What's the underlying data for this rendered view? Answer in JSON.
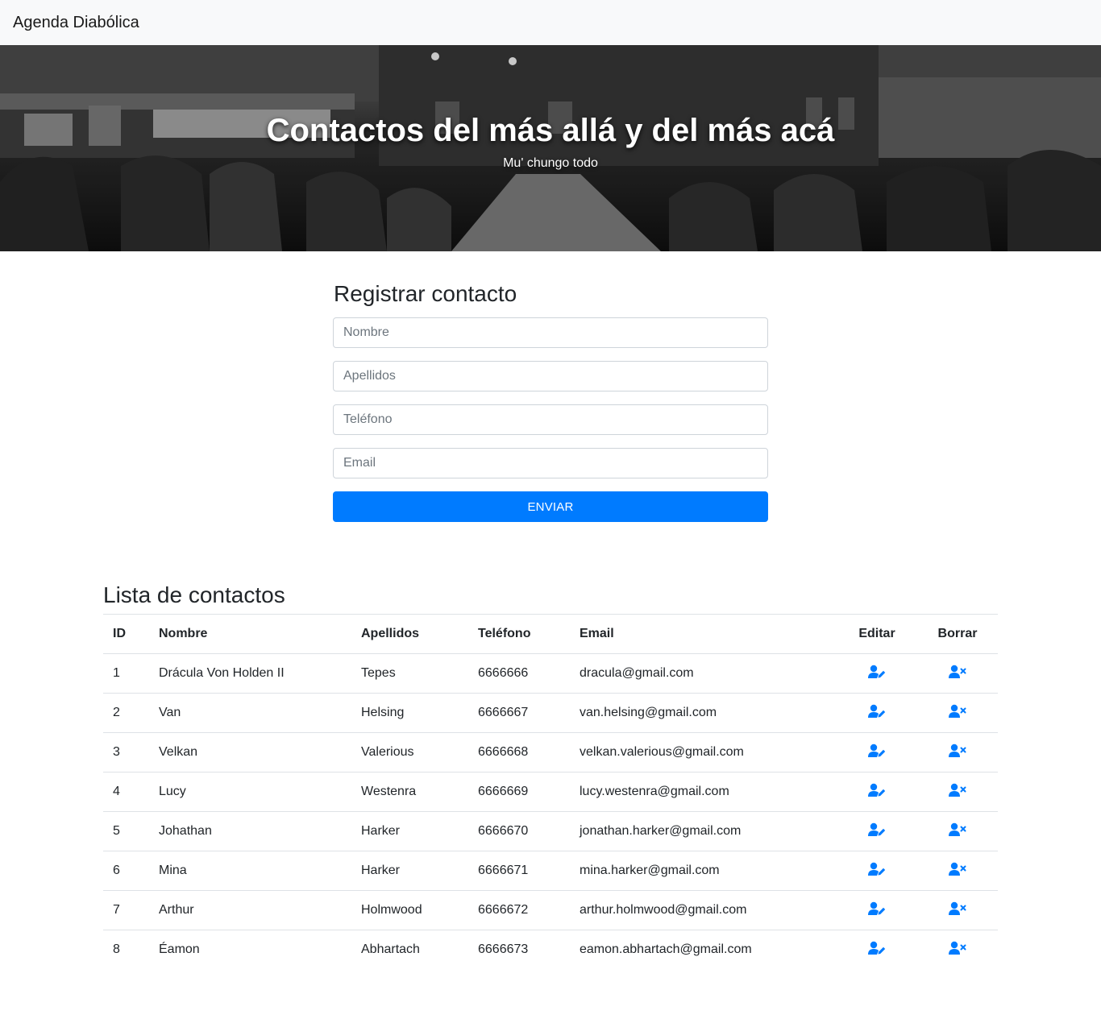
{
  "navbar": {
    "brand": "Agenda Diabólica"
  },
  "hero": {
    "title": "Contactos del más allá y del más acá",
    "subtitle": "Mu' chungo todo"
  },
  "form": {
    "title": "Registrar contacto",
    "fields": {
      "nombre": {
        "placeholder": "Nombre",
        "value": ""
      },
      "apellidos": {
        "placeholder": "Apellidos",
        "value": ""
      },
      "telefono": {
        "placeholder": "Teléfono",
        "value": ""
      },
      "email": {
        "placeholder": "Email",
        "value": ""
      }
    },
    "submit_label": "ENVIAR"
  },
  "list": {
    "title": "Lista de contactos",
    "headers": {
      "id": "ID",
      "nombre": "Nombre",
      "apellidos": "Apellidos",
      "telefono": "Teléfono",
      "email": "Email",
      "editar": "Editar",
      "borrar": "Borrar"
    },
    "rows": [
      {
        "id": "1",
        "nombre": "Drácula Von Holden II",
        "apellidos": "Tepes",
        "telefono": "6666666",
        "email": "dracula@gmail.com"
      },
      {
        "id": "2",
        "nombre": "Van",
        "apellidos": "Helsing",
        "telefono": "6666667",
        "email": "van.helsing@gmail.com"
      },
      {
        "id": "3",
        "nombre": "Velkan",
        "apellidos": "Valerious",
        "telefono": "6666668",
        "email": "velkan.valerious@gmail.com"
      },
      {
        "id": "4",
        "nombre": "Lucy",
        "apellidos": "Westenra",
        "telefono": "6666669",
        "email": "lucy.westenra@gmail.com"
      },
      {
        "id": "5",
        "nombre": "Johathan",
        "apellidos": "Harker",
        "telefono": "6666670",
        "email": "jonathan.harker@gmail.com"
      },
      {
        "id": "6",
        "nombre": "Mina",
        "apellidos": "Harker",
        "telefono": "6666671",
        "email": "mina.harker@gmail.com"
      },
      {
        "id": "7",
        "nombre": "Arthur",
        "apellidos": "Holmwood",
        "telefono": "6666672",
        "email": "arthur.holmwood@gmail.com"
      },
      {
        "id": "8",
        "nombre": "Éamon",
        "apellidos": "Abhartach",
        "telefono": "6666673",
        "email": "eamon.abhartach@gmail.com"
      }
    ],
    "icons": {
      "edit": "user-edit-icon",
      "delete": "user-times-icon"
    }
  },
  "colors": {
    "accent": "#007bff",
    "navbar_bg": "#f8f9fa",
    "border": "#dee2e6"
  }
}
